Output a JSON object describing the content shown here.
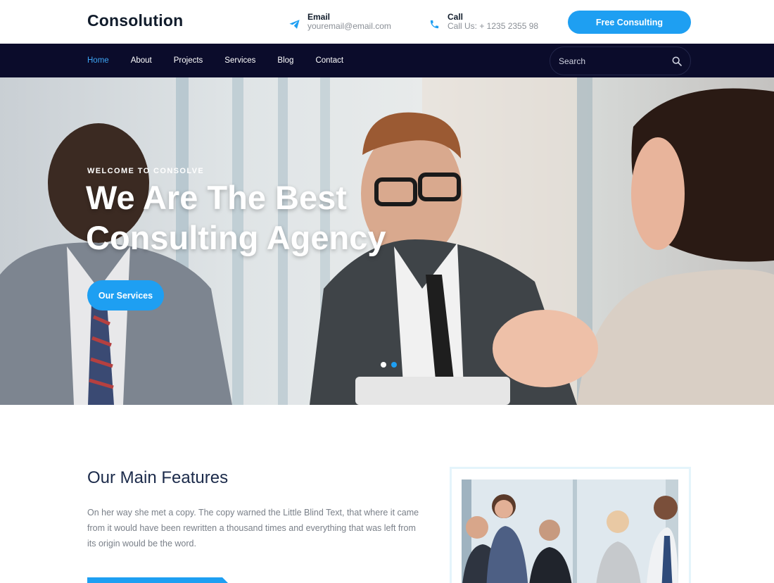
{
  "brand": {
    "name": "Consolution"
  },
  "header": {
    "email": {
      "label": "Email",
      "value": "youremail@email.com",
      "icon": "paper-plane-icon"
    },
    "call": {
      "label": "Call",
      "value": "Call Us: + 1235 2355 98",
      "icon": "phone-icon"
    },
    "cta_label": "Free Consulting"
  },
  "nav": {
    "items": [
      {
        "label": "Home",
        "active": true
      },
      {
        "label": "About",
        "active": false
      },
      {
        "label": "Projects",
        "active": false
      },
      {
        "label": "Services",
        "active": false
      },
      {
        "label": "Blog",
        "active": false
      },
      {
        "label": "Contact",
        "active": false
      }
    ],
    "search_placeholder": "Search"
  },
  "hero": {
    "eyebrow": "WELCOME TO CONSOLVE",
    "title": "We Are The Best Consulting Agency",
    "button_label": "Our Services",
    "slides": {
      "count": 2,
      "active_index": 1
    }
  },
  "features": {
    "title": "Our Main Features",
    "text": "On her way she met a copy. The copy warned the Little Blind Text, that where it came from it would have been rewritten a thousand times and everything that was left from its origin would be the word."
  },
  "colors": {
    "accent": "#1e9ff2",
    "nav_bg": "#0b0c2b",
    "heading": "#1b2a4a"
  }
}
